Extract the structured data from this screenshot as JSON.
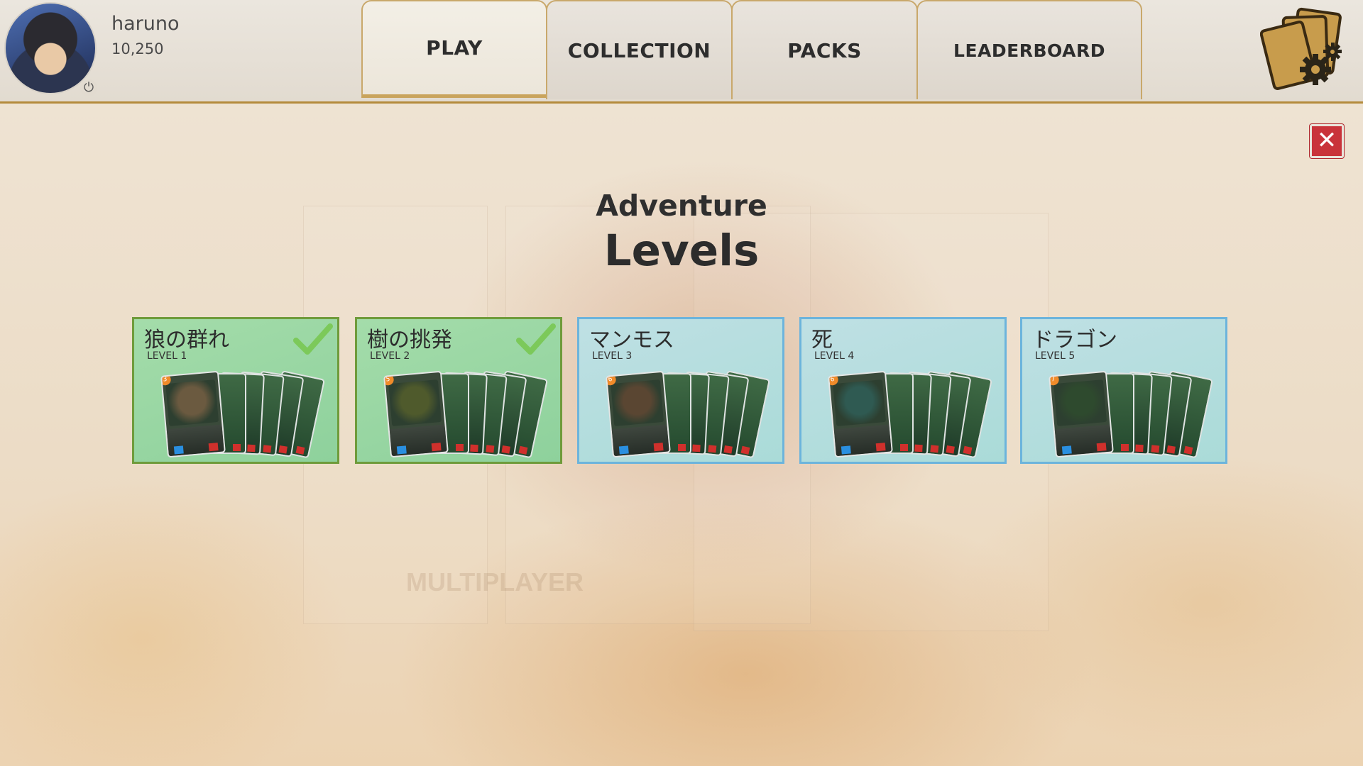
{
  "user": {
    "name": "haruno",
    "coins": "10,250"
  },
  "tabs": [
    {
      "label": "PLAY",
      "active": true
    },
    {
      "label": "COLLECTION",
      "active": false
    },
    {
      "label": "PACKS",
      "active": false
    },
    {
      "label": "LEADERBOARD",
      "active": false
    }
  ],
  "icons": {
    "settings": "cards-gear-icon",
    "close": "close-icon",
    "power": "power-icon",
    "check": "checkmark-icon"
  },
  "close_label": "✕",
  "page": {
    "subtitle": "Adventure",
    "title": "Levels"
  },
  "levels": [
    {
      "name": "狼の群れ",
      "level": "LEVEL 1",
      "completed": true,
      "hero_cost": "3",
      "art_color": "#6b5a40"
    },
    {
      "name": "樹の挑発",
      "level": "LEVEL 2",
      "completed": true,
      "hero_cost": "5",
      "art_color": "#4f5a2c"
    },
    {
      "name": "マンモス",
      "level": "LEVEL 3",
      "completed": false,
      "hero_cost": "6",
      "art_color": "#5a4632"
    },
    {
      "name": "死",
      "level": "LEVEL 4",
      "completed": false,
      "hero_cost": "6",
      "art_color": "#2f5a52"
    },
    {
      "name": "ドラゴン",
      "level": "LEVEL 5",
      "completed": false,
      "hero_cost": "7",
      "art_color": "#2e4a2e"
    }
  ],
  "colors": {
    "completed_bg": "#a4dcaa",
    "completed_border": "#6f9b3b",
    "open_bg": "#bfe0e4",
    "open_border": "#6cb4dc",
    "header_accent": "#b48b3c",
    "close_red": "#c9333a"
  }
}
